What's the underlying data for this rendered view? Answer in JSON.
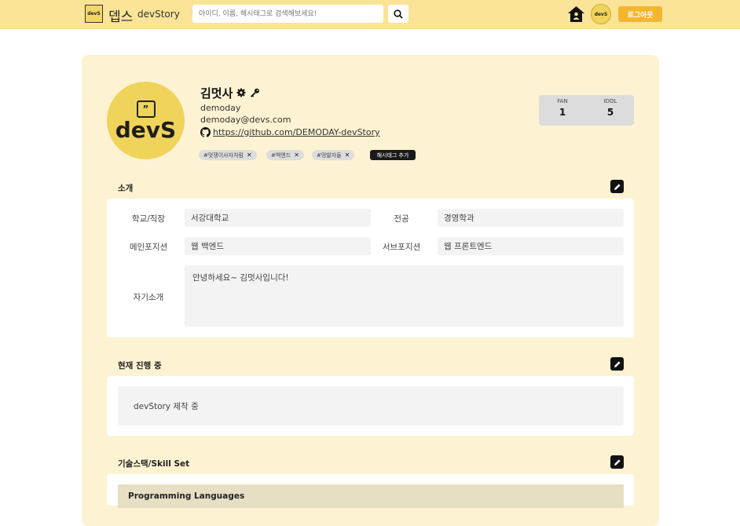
{
  "nav": {
    "brand": "뎁스",
    "brand_sub": "devStory",
    "logo_text": "devS",
    "search_placeholder": "아이디, 이름, 해시태그로 검색해보세요!",
    "logout_label": "로그아웃",
    "avatar_text": "devS"
  },
  "profile": {
    "avatar_text": "devS",
    "avatar_bubble": "”",
    "name": "김멋사",
    "username": "demoday",
    "email": "demoday@devs.com",
    "github": "https://github.com/DEMODAY-devStory",
    "tags": [
      "#멋쟁이사자처럼",
      "#백엔드",
      "#멍발자들"
    ],
    "add_tag_label": "해시태그 추가",
    "fan_label": "FAN",
    "fan_count": "1",
    "idol_label": "IDOL",
    "idol_count": "5"
  },
  "intro": {
    "title": "소개",
    "school_label": "학교/직장",
    "school_value": "서강대학교",
    "major_label": "전공",
    "major_value": "경영학과",
    "main_pos_label": "메인포지션",
    "main_pos_value": "웹 백엔드",
    "sub_pos_label": "서브포지션",
    "sub_pos_value": "웹 프론트엔드",
    "bio_label": "자기소개",
    "bio_value": "안녕하세요~ 김멋사입니다!"
  },
  "progress": {
    "title": "현재 진행 중",
    "value": "devStory 제작 중"
  },
  "skills": {
    "title": "기술스택/Skill Set",
    "group_title": "Programming Languages"
  }
}
